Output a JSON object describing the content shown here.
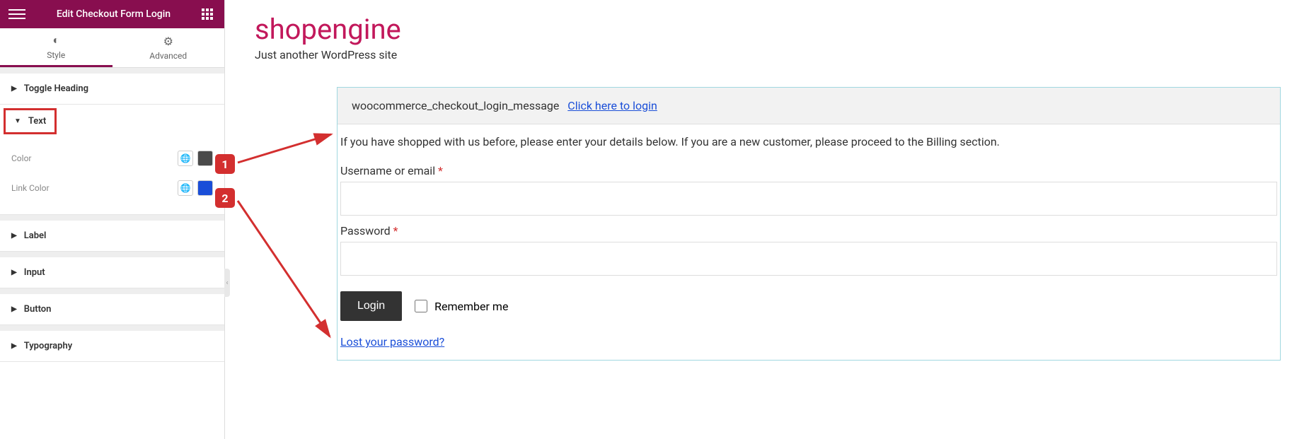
{
  "panel": {
    "title": "Edit Checkout Form Login",
    "tabs": {
      "style": "Style",
      "advanced": "Advanced"
    },
    "sections": {
      "toggle_heading": "Toggle Heading",
      "text": "Text",
      "label": "Label",
      "input": "Input",
      "button": "Button",
      "typography": "Typography"
    },
    "controls": {
      "color_label": "Color",
      "link_color_label": "Link Color",
      "color_value": "#4a4a4a",
      "link_color_value": "#1a4ed8"
    }
  },
  "site": {
    "title": "shopengine",
    "tagline": "Just another WordPress site"
  },
  "form": {
    "message_prefix": "woocommerce_checkout_login_message",
    "message_link": "Click here to login",
    "helper": "If you have shopped with us before, please enter your details below. If you are a new customer, please proceed to the Billing section.",
    "username_label": "Username or email",
    "password_label": "Password",
    "required_mark": "*",
    "login_button": "Login",
    "remember_label": "Remember me",
    "lost_password": "Lost your password?"
  },
  "annotations": {
    "one": "1",
    "two": "2"
  }
}
